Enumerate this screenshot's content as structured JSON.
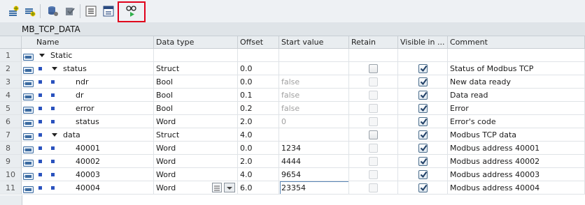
{
  "block_title": "MB_TCP_DATA",
  "columns": {
    "name": "Name",
    "data_type": "Data type",
    "offset": "Offset",
    "start_value": "Start value",
    "retain": "Retain",
    "visible": "Visible in ...",
    "comment": "Comment"
  },
  "rows": [
    {
      "num": "1",
      "name": "Static",
      "data_type": "",
      "offset": "",
      "start_value": "",
      "comment": "",
      "retain": "none",
      "visible": "none"
    },
    {
      "num": "2",
      "name": "status",
      "data_type": "Struct",
      "offset": "0.0",
      "start_value": "",
      "comment": "Status of Modbus TCP",
      "retain": "unchecked",
      "visible": "checked"
    },
    {
      "num": "3",
      "name": "ndr",
      "data_type": "Bool",
      "offset": "0.0",
      "start_value": "false",
      "comment": "New data ready",
      "retain": "disabled",
      "visible": "checked"
    },
    {
      "num": "4",
      "name": "dr",
      "data_type": "Bool",
      "offset": "0.1",
      "start_value": "false",
      "comment": "Data read",
      "retain": "disabled",
      "visible": "checked"
    },
    {
      "num": "5",
      "name": "error",
      "data_type": "Bool",
      "offset": "0.2",
      "start_value": "false",
      "comment": "Error",
      "retain": "disabled",
      "visible": "checked"
    },
    {
      "num": "6",
      "name": "status",
      "data_type": "Word",
      "offset": "2.0",
      "start_value": "0",
      "comment": "Error's code",
      "retain": "disabled",
      "visible": "checked"
    },
    {
      "num": "7",
      "name": "data",
      "data_type": "Struct",
      "offset": "4.0",
      "start_value": "",
      "comment": "Modbus TCP data",
      "retain": "unchecked",
      "visible": "checked"
    },
    {
      "num": "8",
      "name": "40001",
      "data_type": "Word",
      "offset": "0.0",
      "start_value": "1234",
      "comment": "Modbus address 40001",
      "retain": "disabled",
      "visible": "checked"
    },
    {
      "num": "9",
      "name": "40002",
      "data_type": "Word",
      "offset": "2.0",
      "start_value": "4444",
      "comment": "Modbus address 40002",
      "retain": "disabled",
      "visible": "checked"
    },
    {
      "num": "10",
      "name": "40003",
      "data_type": "Word",
      "offset": "4.0",
      "start_value": "9654",
      "comment": "Modbus address 40003",
      "retain": "disabled",
      "visible": "checked"
    },
    {
      "num": "11",
      "name": "40004",
      "data_type": "Word",
      "offset": "6.0",
      "start_value": "23354",
      "comment": "Modbus address 40004",
      "retain": "disabled",
      "visible": "checked"
    }
  ],
  "toolbar": {
    "icons": [
      "insert-row-icon",
      "add-row-icon",
      "snapshot-icon",
      "copy-snapshot-icon",
      "expand-all-icon",
      "collapse-icon",
      "monitor-glasses-icon"
    ]
  },
  "colors": {
    "highlight": "#e0001b",
    "checkbox_check": "#1f3f66",
    "bullet": "#2a52be"
  }
}
